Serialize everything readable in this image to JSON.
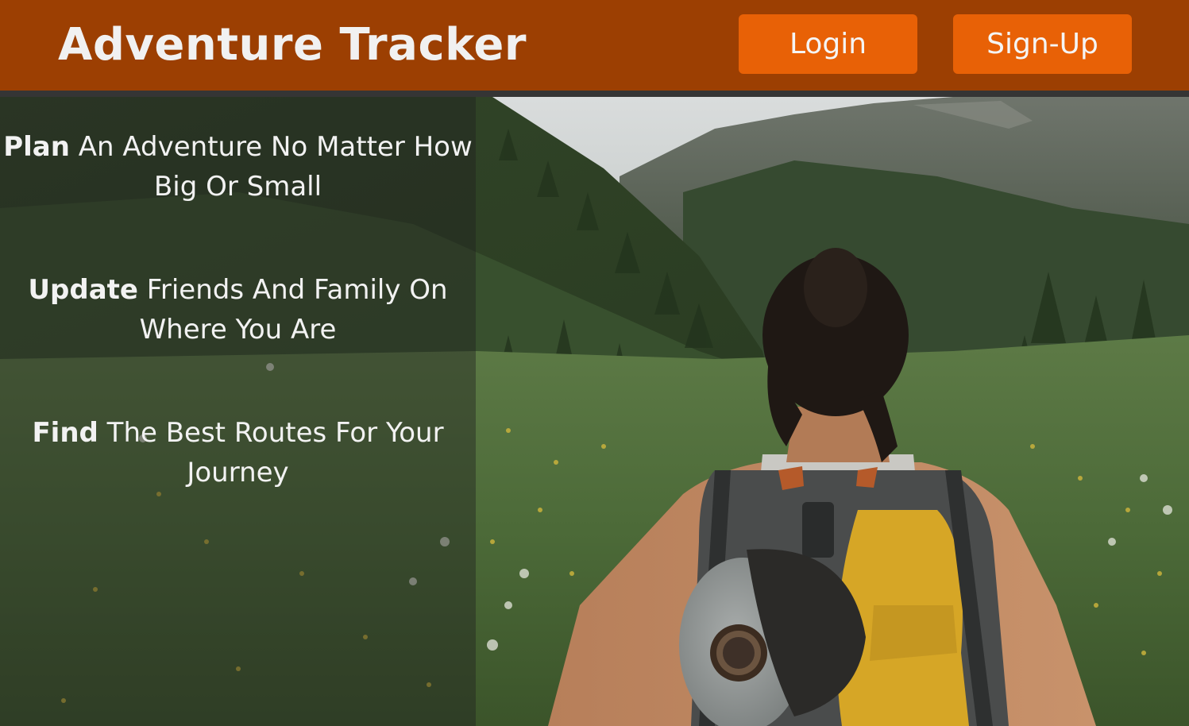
{
  "header": {
    "title": "Adventure Tracker",
    "login_label": "Login",
    "signup_label": "Sign-Up"
  },
  "features": [
    {
      "keyword": "Plan",
      "text": " An Adventure No Matter How Big Or Small"
    },
    {
      "keyword": "Update",
      "text": " Friends And Family On Where You Are"
    },
    {
      "keyword": "Find",
      "text": " The Best Routes For Your Journey"
    }
  ],
  "colors": {
    "header_bg": "#9c3f02",
    "button_bg": "#e86106",
    "title_text": "#f1f1f1"
  }
}
